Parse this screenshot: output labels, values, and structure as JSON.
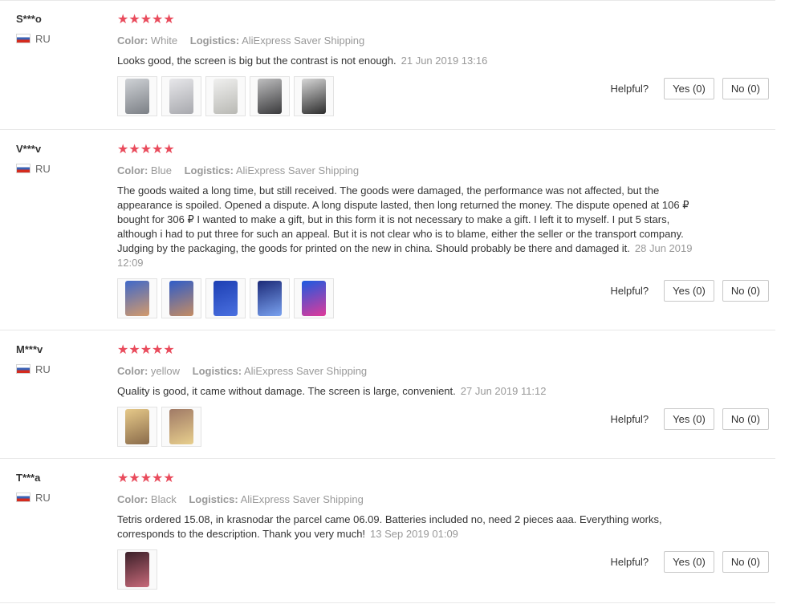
{
  "helpful_label": "Helpful?",
  "star_glyph": "★★★★★",
  "colors": {
    "star": "#e94b5c",
    "meta": "#999999",
    "text": "#333333",
    "border": "#e8e8e8"
  },
  "reviews": [
    {
      "user": "S***o",
      "country": "RU",
      "color_label": "Color:",
      "color_value": "White",
      "logistics_label": "Logistics:",
      "logistics_value": "AliExpress Saver Shipping",
      "text": "Looks good, the screen is big but the contrast is not enough.",
      "date": "21 Jun 2019 13:16",
      "yes": "Yes (0)",
      "no": "No (0)"
    },
    {
      "user": "V***v",
      "country": "RU",
      "color_label": "Color:",
      "color_value": "Blue",
      "logistics_label": "Logistics:",
      "logistics_value": "AliExpress Saver Shipping",
      "text": "The goods waited a long time, but still received. The goods were damaged, the performance was not affected, but the appearance is spoiled. Opened a dispute. A long dispute lasted, then long returned the money. The dispute opened at 106 ₽ bought for 306 ₽ I wanted to make a gift, but in this form it is not necessary to make a gift. I left it to myself. I put 5 stars, although i had to put three for such an appeal. But it is not clear who is to blame, either the seller or the transport company. Judging by the packaging, the goods for printed on the new in china. Should probably be there and damaged it.",
      "date": "28 Jun 2019 12:09",
      "yes": "Yes (0)",
      "no": "No (0)"
    },
    {
      "user": "M***v",
      "country": "RU",
      "color_label": "Color:",
      "color_value": "yellow",
      "logistics_label": "Logistics:",
      "logistics_value": "AliExpress Saver Shipping",
      "text": "Quality is good, it came without damage. The screen is large, convenient.",
      "date": "27 Jun 2019 11:12",
      "yes": "Yes (0)",
      "no": "No (0)"
    },
    {
      "user": "T***a",
      "country": "RU",
      "color_label": "Color:",
      "color_value": "Black",
      "logistics_label": "Logistics:",
      "logistics_value": "AliExpress Saver Shipping",
      "text": "Tetris ordered 15.08, in krasnodar the parcel came 06.09. Batteries included no, need 2 pieces aaa. Everything works, corresponds to the description. Thank you very much!",
      "date": "13 Sep 2019 01:09",
      "yes": "Yes (0)",
      "no": "No (0)"
    }
  ]
}
